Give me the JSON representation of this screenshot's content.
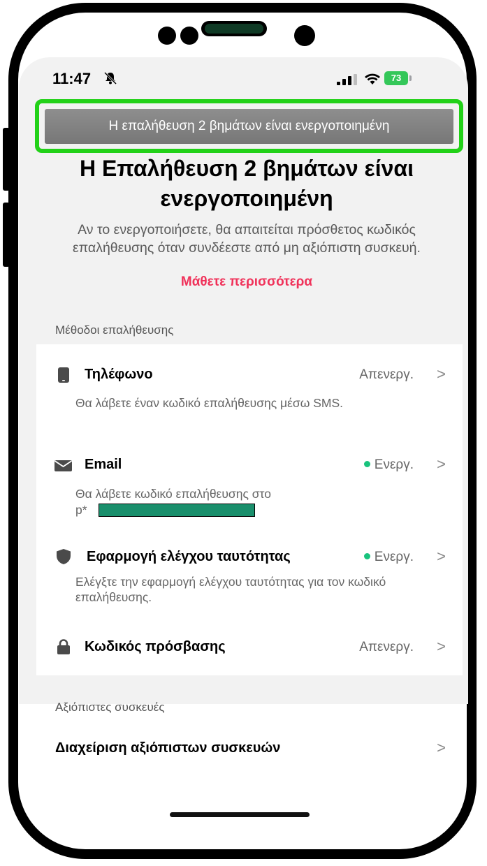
{
  "status_bar": {
    "time": "11:47",
    "battery": "73"
  },
  "banner": {
    "text": "Η επαλήθευση 2 βημάτων είναι ενεργοποιημένη"
  },
  "page": {
    "title": "Η Επαλήθευση 2 βημάτων είναι ενεργοποιημένη",
    "description": "Αν το ενεργοποιήσετε, θα απαιτείται πρόσθετος κωδικός επαλήθευσης όταν συνδέεστε από μη αξιόπιστη συσκευή.",
    "learn_more": "Μάθετε περισσότερα"
  },
  "methods": {
    "section_label": "Μέθοδοι επαλήθευσης",
    "items": [
      {
        "icon": "phone-icon",
        "title": "Τηλέφωνο",
        "status": "Απενεργ.",
        "active": false,
        "description": "Θα λάβετε έναν κωδικό επαλήθευσης μέσω SMS."
      },
      {
        "icon": "mail-icon",
        "title": "Email",
        "status": "Ενεργ.",
        "active": true,
        "description": "Θα λάβετε κωδικό επαλήθευσης στο",
        "value_prefix": "p*"
      },
      {
        "icon": "shield-icon",
        "title": "Εφαρμογή ελέγχου ταυτότητας",
        "status": "Ενεργ.",
        "active": true,
        "description": "Ελέγξτε την εφαρμογή ελέγχου ταυτότητας για τον κωδικό επαλήθευσης."
      },
      {
        "icon": "lock-icon",
        "title": "Κωδικός πρόσβασης",
        "status": "Απενεργ.",
        "active": false
      }
    ]
  },
  "trusted": {
    "section_label": "Αξιόπιστες συσκευές",
    "manage_label": "Διαχείριση αξιόπιστων συσκευών"
  },
  "chevron": ">",
  "colors": {
    "accent_pink": "#f0325a",
    "active_green": "#19c37d",
    "highlight_green": "#22d118",
    "battery_green": "#34c759"
  }
}
